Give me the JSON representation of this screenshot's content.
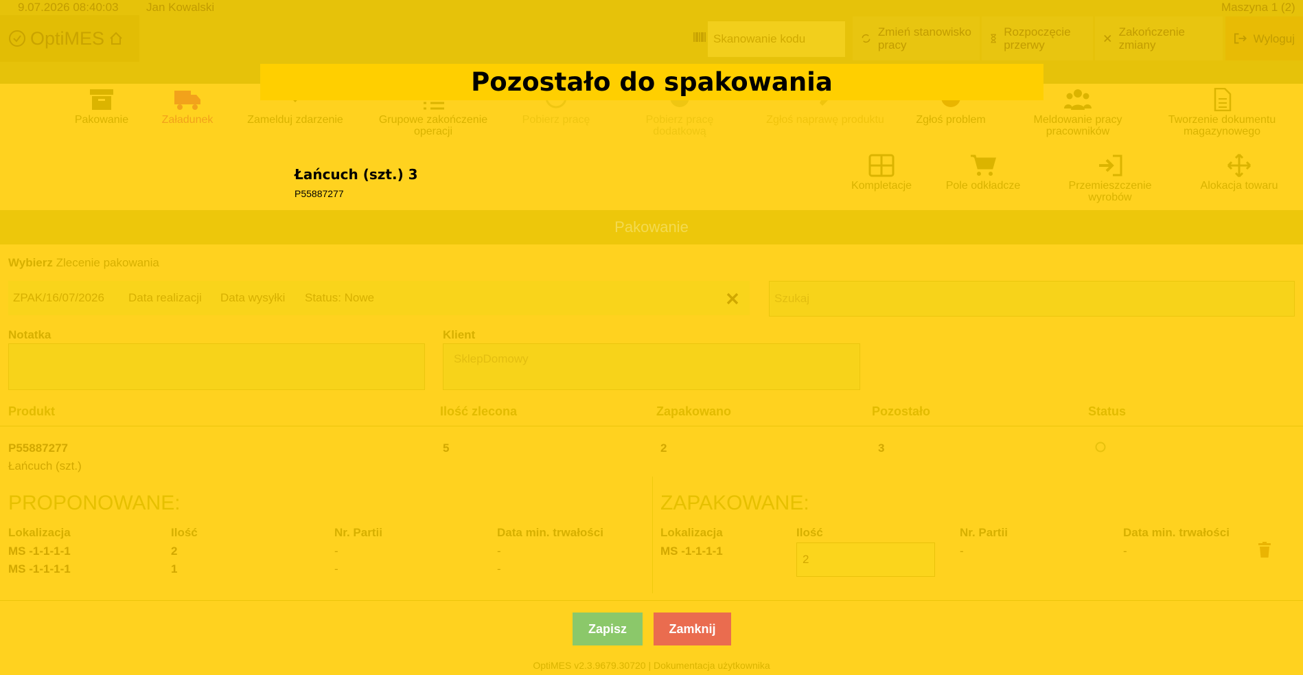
{
  "status_bar": {
    "datetime": "9.07.2026 08:40:03",
    "user": "Jan Kowalski",
    "machine": "Maszyna 1 (2)"
  },
  "brand": {
    "name": "OptiMES"
  },
  "topbar": {
    "scan_placeholder": "Skanowanie kodu",
    "change_station": "Zmień stanowisko pracy",
    "start_break": "Rozpoczęcie przerwy",
    "end_shift": "Zakończenie zmiany",
    "logout": "Wyloguj"
  },
  "modal": {
    "title": "Pozostało do spakowania"
  },
  "nav": {
    "row1": [
      {
        "label": "Pakowanie",
        "icon": "box-icon"
      },
      {
        "label": "Załadunek",
        "icon": "truck-icon"
      },
      {
        "label": "Zamelduj zdarzenie",
        "icon": "check-icon"
      },
      {
        "label": "Grupowe zakończenie operacji",
        "icon": "list-icon"
      },
      {
        "label": "Pobierz pracę",
        "icon": "play-icon"
      },
      {
        "label": "Pobierz pracę dodatkową",
        "icon": "plus-icon"
      },
      {
        "label": "Zgłoś naprawę produktu",
        "icon": "wrench-icon"
      },
      {
        "label": "Zgłoś problem",
        "icon": "alert-icon"
      },
      {
        "label": "Meldowanie pracy pracowników",
        "icon": "users-icon"
      },
      {
        "label": "Tworzenie dokumentu magazynowego",
        "icon": "document-icon"
      }
    ],
    "row2": [
      {
        "label": "Kompletacje",
        "icon": "grid-icon"
      },
      {
        "label": "Pole odkładcze",
        "icon": "cart-icon"
      },
      {
        "label": "Przemieszczenie wyrobów",
        "icon": "sign-in-icon"
      },
      {
        "label": "Alokacja towaru",
        "icon": "move-icon"
      }
    ]
  },
  "summary": {
    "title": "Łańcuch (szt.) 3",
    "code": "P55887277"
  },
  "section": {
    "title": "Pakowanie"
  },
  "order": {
    "choose_bold": "Wybierz",
    "choose_rest": "Zlecenie pakowania",
    "number": "ZPAK/16/07/2026",
    "realization": "Data realizacji",
    "shipping": "Data wysyłki",
    "status": "Status: Nowe",
    "search_placeholder": "Szukaj"
  },
  "note": {
    "label": "Notatka",
    "value": ""
  },
  "client": {
    "label": "Klient",
    "value": "SklepDomowy"
  },
  "table": {
    "headers": [
      "Produkt",
      "Ilość zlecona",
      "Zapakowano",
      "Pozostało",
      "Status"
    ],
    "row": {
      "code": "P55887277",
      "name": "Łańcuch (szt.)",
      "ordered": "5",
      "packed": "2",
      "remaining": "3"
    }
  },
  "proposed": {
    "title": "PROPONOWANE:",
    "headers": [
      "Lokalizacja",
      "Ilość",
      "Nr. Partii",
      "Data min. trwałości"
    ],
    "rows": [
      [
        "MS -1-1-1-1",
        "2",
        "-",
        "-"
      ],
      [
        "MS -1-1-1-1",
        "1",
        "-",
        "-"
      ]
    ]
  },
  "packed": {
    "title": "ZAPAKOWANE:",
    "headers": [
      "Lokalizacja",
      "Ilość",
      "Nr. Partii",
      "Data min. trwałości"
    ],
    "row": {
      "location": "MS -1-1-1-1",
      "qty": "2",
      "batch": "-",
      "date": "-"
    }
  },
  "buttons": {
    "save": "Zapisz",
    "close": "Zamknij"
  },
  "footer": {
    "version": "OptiMES v2.3.9679.30720",
    "sep": "|",
    "docs": "Dokumentacja użytkownika"
  },
  "colors": {
    "save": "#8bc86a",
    "close": "#ea6c4f",
    "modal_header": "#ffcf00"
  }
}
